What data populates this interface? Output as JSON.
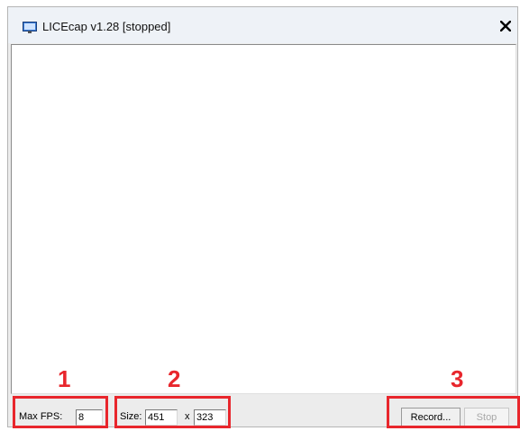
{
  "window": {
    "title": "LICEcap v1.28 [stopped]",
    "icon": "screen-capture-icon",
    "close_glyph": "✕"
  },
  "controls": {
    "max_fps_label": "Max FPS:",
    "max_fps_value": "8",
    "size_label": "Size:",
    "width_value": "451",
    "size_separator": "x",
    "height_value": "323",
    "record_label": "Record...",
    "stop_label": "Stop"
  },
  "annotations": {
    "fps_number": "1",
    "size_number": "2",
    "buttons_number": "3",
    "color": "#e8262c"
  }
}
